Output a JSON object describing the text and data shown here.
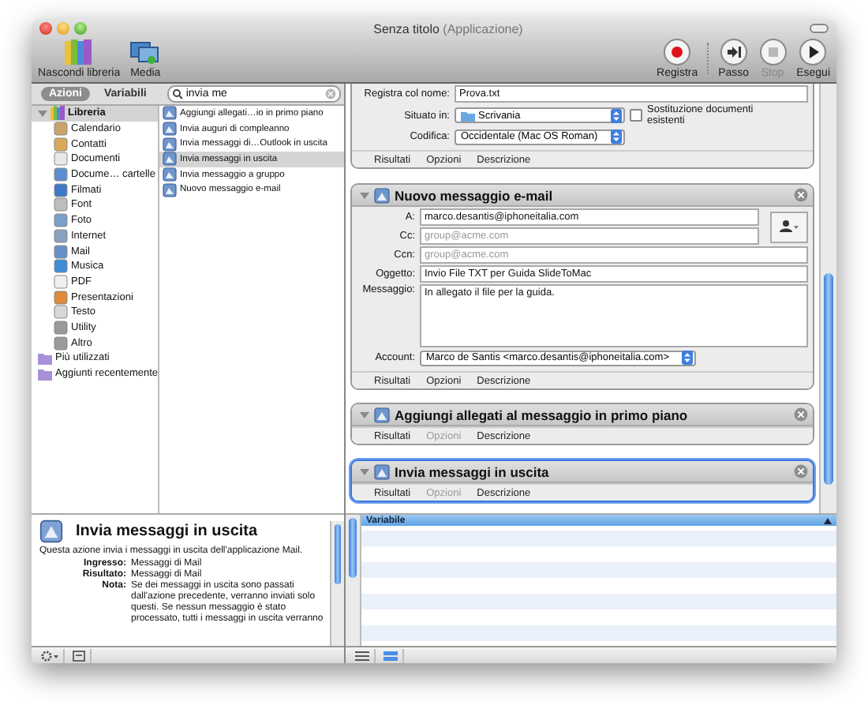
{
  "window": {
    "title": "Senza titolo",
    "subtitle": "(Applicazione)"
  },
  "toolbar": {
    "left": [
      {
        "label": "Nascondi libreria",
        "kind": "library"
      },
      {
        "label": "Media",
        "kind": "media"
      }
    ],
    "right": [
      {
        "label": "Registra",
        "kind": "record",
        "disabled": false
      },
      {
        "label": "Passo",
        "kind": "step",
        "disabled": false
      },
      {
        "label": "Stop",
        "kind": "stop",
        "disabled": true
      },
      {
        "label": "Esegui",
        "kind": "run",
        "disabled": false
      }
    ]
  },
  "library": {
    "tabs": [
      {
        "label": "Azioni",
        "selected": true
      },
      {
        "label": "Variabili",
        "selected": false
      }
    ],
    "search": {
      "value": "invia me"
    },
    "tree": [
      {
        "label": "Libreria",
        "selected": true,
        "expanded": true,
        "children": [
          {
            "label": "Calendario",
            "selected": false
          },
          {
            "label": "Contatti",
            "selected": false
          },
          {
            "label": "Documenti",
            "selected": false
          },
          {
            "label": "Docume… cartelle",
            "selected": false
          },
          {
            "label": "Filmati",
            "selected": false
          },
          {
            "label": "Font",
            "selected": false
          },
          {
            "label": "Foto",
            "selected": false
          },
          {
            "label": "Internet",
            "selected": false
          },
          {
            "label": "Mail",
            "selected": false
          },
          {
            "label": "Musica",
            "selected": false
          },
          {
            "label": "PDF",
            "selected": false
          },
          {
            "label": "Presentazioni",
            "selected": false
          },
          {
            "label": "Testo",
            "selected": false
          },
          {
            "label": "Utility",
            "selected": false
          },
          {
            "label": "Altro",
            "selected": false
          }
        ]
      },
      {
        "label": "Più utilizzati",
        "selected": false
      },
      {
        "label": "Aggiunti recentemente",
        "selected": false
      }
    ],
    "actions": [
      {
        "label": "Aggiungi allegati…io in primo piano",
        "selected": false
      },
      {
        "label": "Invia auguri di compleanno",
        "selected": false
      },
      {
        "label": "Invia messaggi di…Outlook in uscita",
        "selected": false
      },
      {
        "label": "Invia messaggi in uscita",
        "selected": true
      },
      {
        "label": "Invia messaggio a gruppo",
        "selected": false
      },
      {
        "label": "Nuovo messaggio e-mail",
        "selected": false
      }
    ]
  },
  "description": {
    "title": "Invia messaggi in uscita",
    "summary": "Questa azione invia i messaggi in uscita dell'applicazione Mail.",
    "rows": [
      {
        "label": "Ingresso:",
        "value": "Messaggi di Mail"
      },
      {
        "label": "Risultato:",
        "value": "Messaggi di Mail"
      },
      {
        "label": "Nota:",
        "value": "Se dei messaggi in uscita sono passati dall'azione precedente, verranno inviati solo questi.  Se nessun messaggio è stato processato, tutti i messaggi in uscita verranno"
      }
    ]
  },
  "workflow": {
    "actions": [
      {
        "selected": false,
        "fields": [
          {
            "kind": "text",
            "label": "Registra col nome:",
            "value": "Prova.txt"
          },
          {
            "kind": "popup",
            "label": "Situato in:",
            "value": "Scrivania",
            "checkbox": {
              "label": "Sostituzione documenti esistenti",
              "checked": false
            }
          },
          {
            "kind": "popup",
            "label": "Codifica:",
            "value": "Occidentale (Mac OS Roman)"
          }
        ],
        "footer": [
          {
            "label": "Risultati",
            "disabled": false
          },
          {
            "label": "Opzioni",
            "disabled": false
          },
          {
            "label": "Descrizione",
            "disabled": false
          }
        ]
      },
      {
        "title": "Nuovo messaggio e-mail",
        "selected": false,
        "fields": [
          {
            "kind": "text",
            "label": "A:",
            "value": "marco.desantis@iphoneitalia.com"
          },
          {
            "kind": "text",
            "label": "Cc:",
            "placeholder": "group@acme.com"
          },
          {
            "kind": "text",
            "label": "Ccn:",
            "placeholder": "group@acme.com"
          },
          {
            "kind": "text",
            "label": "Oggetto:",
            "value": "Invio File TXT per Guida SlideToMac"
          },
          {
            "kind": "textarea",
            "label": "Messaggio:",
            "value": "In allegato il file per la guida."
          },
          {
            "kind": "popup",
            "label": "Account:",
            "value": "Marco de Santis <marco.desantis@iphoneitalia.com>"
          }
        ],
        "footer": [
          {
            "label": "Risultati",
            "disabled": false
          },
          {
            "label": "Opzioni",
            "disabled": false
          },
          {
            "label": "Descrizione",
            "disabled": false
          }
        ]
      },
      {
        "title": "Aggiungi allegati al messaggio in primo piano",
        "selected": false,
        "footer": [
          {
            "label": "Risultati",
            "disabled": false
          },
          {
            "label": "Opzioni",
            "disabled": true
          },
          {
            "label": "Descrizione",
            "disabled": false
          }
        ]
      },
      {
        "title": "Invia messaggi in uscita",
        "selected": true,
        "footer": [
          {
            "label": "Risultati",
            "disabled": false
          },
          {
            "label": "Opzioni",
            "disabled": true
          },
          {
            "label": "Descrizione",
            "disabled": false
          }
        ]
      }
    ]
  },
  "variables": {
    "column": "Variabile"
  }
}
